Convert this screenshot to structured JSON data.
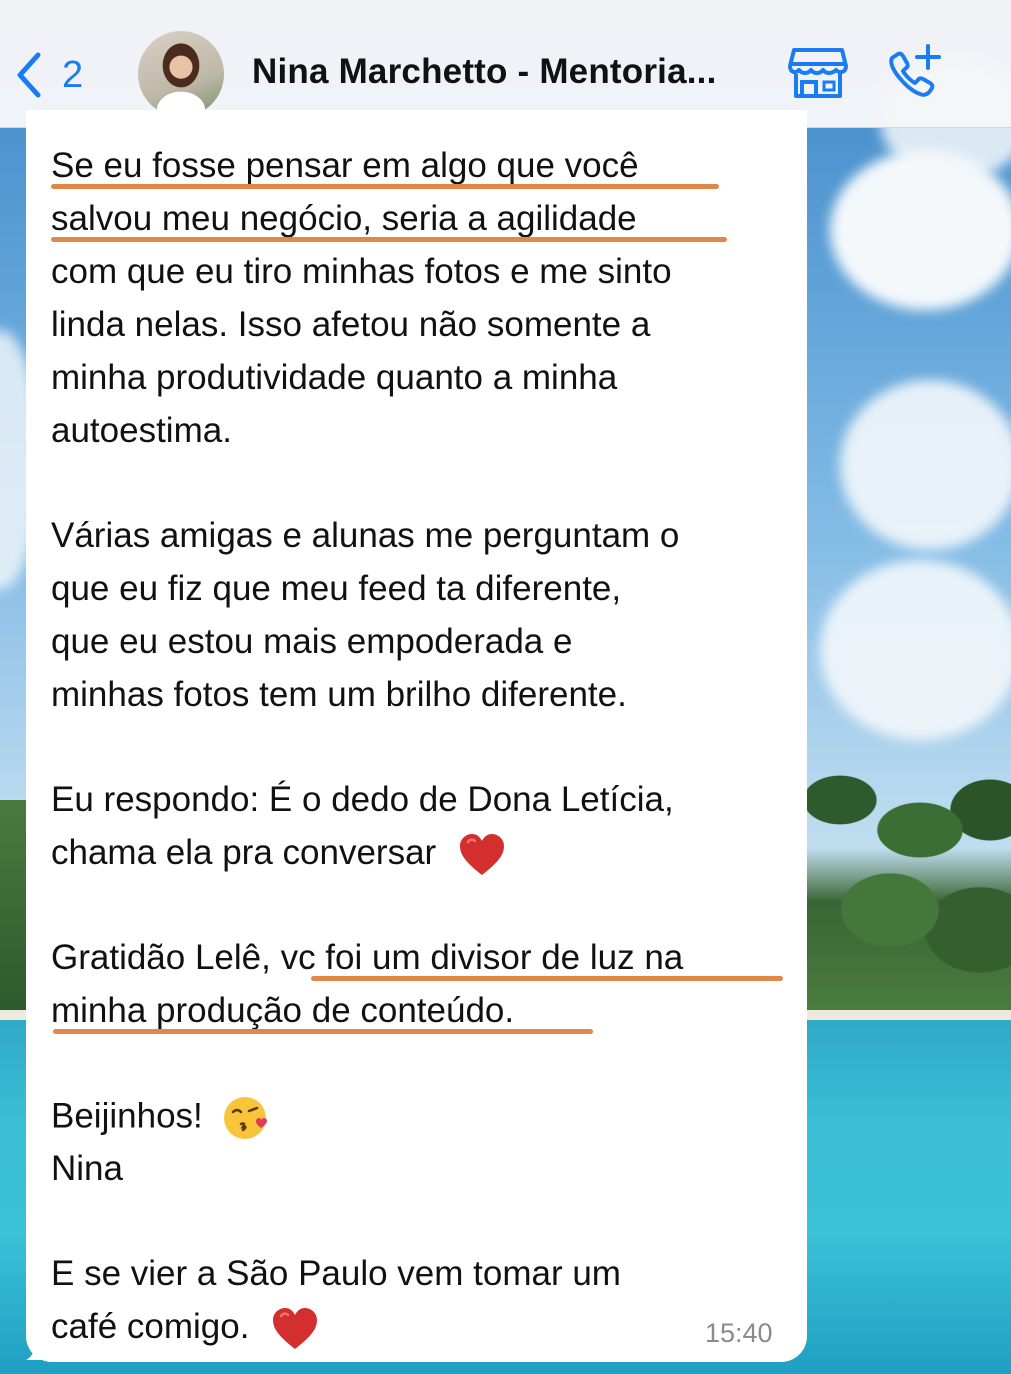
{
  "header": {
    "back_count": "2",
    "contact_name": "Nina Marchetto - Mentoria..."
  },
  "message": {
    "lines": [
      "Se eu fosse pensar em algo que você",
      "salvou meu negócio, seria a agilidade",
      "com que eu tiro minhas fotos e me sinto",
      "linda nelas. Isso afetou não somente a",
      "minha produtividade quanto a minha",
      "autoestima.",
      "Várias amigas e alunas me perguntam o",
      "que eu fiz que meu feed ta diferente,",
      "que eu estou mais empoderada e",
      "minhas fotos tem um brilho diferente.",
      "Eu respondo: É o dedo de Dona Letícia,",
      "chama ela pra conversar",
      "Gratidão Lelê, vc foi um divisor de luz na",
      "minha produção de conteúdo.",
      "Beijinhos!",
      "Nina",
      "E se vier a São Paulo vem tomar um",
      "café comigo."
    ],
    "timestamp": "15:40"
  },
  "colors": {
    "accent": "#1a7cf5",
    "underline": "#e2874a",
    "heart": "#d32f2f"
  },
  "icons": [
    "chevron-left-icon",
    "business-store-icon",
    "add-call-icon",
    "heart-emoji-icon",
    "kiss-emoji-icon"
  ]
}
